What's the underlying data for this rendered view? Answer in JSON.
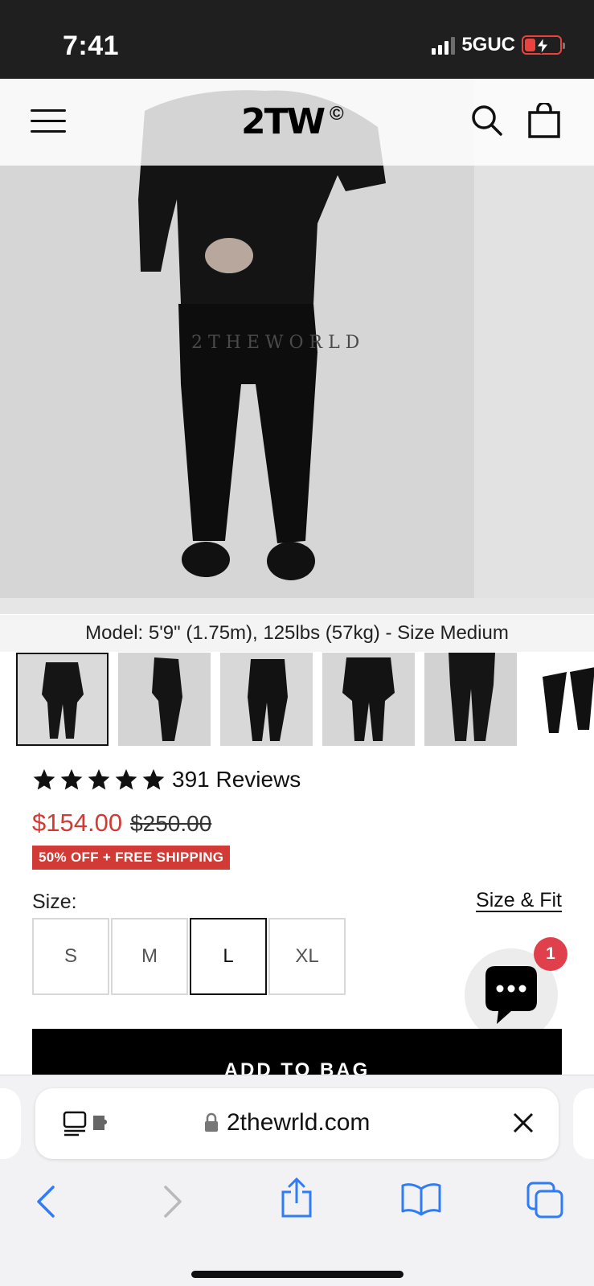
{
  "status_bar": {
    "time": "7:41",
    "network": "5GUC",
    "battery_level": 0.3
  },
  "header": {
    "logo": "2TW",
    "logo_mark": "©",
    "icons": [
      "menu-icon",
      "search-icon",
      "shopping-bag-icon"
    ]
  },
  "product": {
    "image_caption": "Model: 5'9\" (1.75m), 125lbs (57kg) - Size Medium",
    "thumbnail_count": 6,
    "selected_thumbnail": 0,
    "rating": 5,
    "reviews_label": "391 Reviews",
    "price": "$154.00",
    "compare_price": "$250.00",
    "promo_badge": "50% OFF + FREE SHIPPING",
    "size_label": "Size:",
    "size_fit_link": "Size & Fit",
    "sizes": [
      "S",
      "M",
      "L",
      "XL"
    ],
    "selected_size": "L",
    "add_to_bag": "ADD TO BAG"
  },
  "chat": {
    "badge_count": "1"
  },
  "browser": {
    "url": "2thewrld.com",
    "nav": [
      "back-icon",
      "forward-icon",
      "share-icon",
      "bookmarks-icon",
      "tabs-icon"
    ]
  },
  "colors": {
    "accent_red": "#d23a35",
    "badge_red": "#e0404b",
    "ios_blue": "#2f7cf6"
  }
}
